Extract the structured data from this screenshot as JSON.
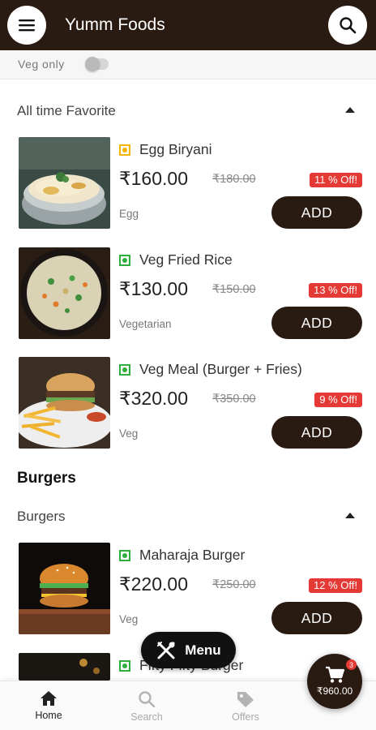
{
  "app": {
    "title": "Yumm Foods"
  },
  "veg_filter": {
    "label": "Veg only",
    "enabled": false
  },
  "sections": [
    {
      "title": "All time Favorite"
    },
    {
      "title": "Burgers"
    }
  ],
  "category": {
    "title": "Burgers"
  },
  "items": [
    {
      "name": "Egg Biryani",
      "price": "₹160.00",
      "old_price": "₹180.00",
      "discount": "11 % Off!",
      "tag": "Egg",
      "diet": "egg",
      "add_label": "ADD"
    },
    {
      "name": "Veg Fried Rice",
      "price": "₹130.00",
      "old_price": "₹150.00",
      "discount": "13 % Off!",
      "tag": "Vegetarian",
      "diet": "veg",
      "add_label": "ADD"
    },
    {
      "name": "Veg Meal (Burger + Fries)",
      "price": "₹320.00",
      "old_price": "₹350.00",
      "discount": "9 % Off!",
      "tag": "Veg",
      "diet": "veg",
      "add_label": "ADD"
    },
    {
      "name": "Maharaja Burger",
      "price": "₹220.00",
      "old_price": "₹250.00",
      "discount": "12 % Off!",
      "tag": "Veg",
      "diet": "veg",
      "add_label": "ADD"
    },
    {
      "name": "Fifty Fifty Burger",
      "diet": "veg"
    }
  ],
  "menu_button": {
    "label": "Menu"
  },
  "cart": {
    "count": "3",
    "total": "₹960.00"
  },
  "nav": [
    {
      "label": "Home",
      "icon": "home-icon",
      "active": true
    },
    {
      "label": "Search",
      "icon": "search-icon",
      "active": false
    },
    {
      "label": "Offers",
      "icon": "tag-icon",
      "active": false
    }
  ],
  "colors": {
    "brand": "#2a1b12",
    "discount": "#e53935",
    "veg": "#2eae3a",
    "egg": "#f4b400"
  }
}
